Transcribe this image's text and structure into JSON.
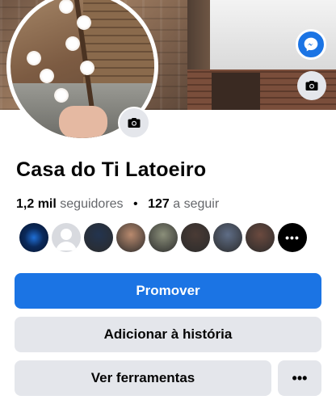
{
  "page": {
    "name": "Casa do Ti Latoeiro",
    "followers_count": "1,2 mil",
    "followers_label": "seguidores",
    "separator": "•",
    "following_count": "127",
    "following_label": "a seguir"
  },
  "icons": {
    "avatar_camera": "camera-icon",
    "cover_camera": "camera-icon",
    "messenger": "messenger-icon",
    "more": "more-dots-icon"
  },
  "colors": {
    "primary": "#1b74e4",
    "secondary_button": "#e4e6eb",
    "muted_text": "#65676b"
  },
  "follower_avatars": [
    {
      "name": "follower-avatar-1",
      "color": "#0a1a3a"
    },
    {
      "name": "follower-avatar-2",
      "color": "#d8dadf"
    },
    {
      "name": "follower-avatar-3",
      "color": "#23344f"
    },
    {
      "name": "follower-avatar-4",
      "color": "#b98a6e"
    },
    {
      "name": "follower-avatar-5",
      "color": "#8b8f7a"
    },
    {
      "name": "follower-avatar-6",
      "color": "#4a3b35"
    },
    {
      "name": "follower-avatar-7",
      "color": "#5f6d86"
    },
    {
      "name": "follower-avatar-8",
      "color": "#6b4a3f"
    }
  ],
  "more_followers_label": "•••",
  "actions": {
    "promote": "Promover",
    "add_story": "Adicionar à história",
    "tools": "Ver ferramentas",
    "more": "•••"
  }
}
